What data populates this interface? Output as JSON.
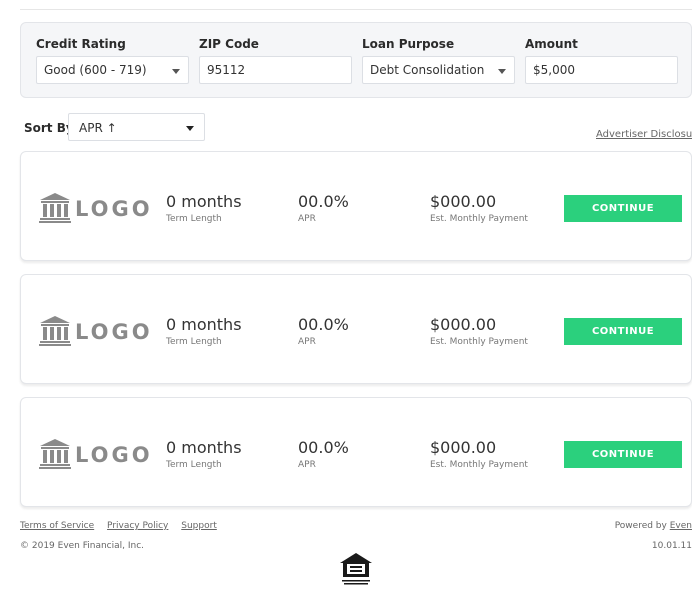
{
  "filters": {
    "credit_rating": {
      "label": "Credit Rating",
      "value": "Good (600 - 719)"
    },
    "zip_code": {
      "label": "ZIP Code",
      "value": "95112"
    },
    "loan_purpose": {
      "label": "Loan Purpose",
      "value": "Debt Consolidation"
    },
    "amount": {
      "label": "Amount",
      "value": "$5,000"
    }
  },
  "sort": {
    "label": "Sort By",
    "value": "APR ↑"
  },
  "disclosure": "Advertiser Disclosure",
  "offers": [
    {
      "logo": "LOGO",
      "term": "0 months",
      "term_label": "Term Length",
      "apr": "00.0%",
      "apr_label": "APR",
      "payment": "$000.00",
      "payment_label": "Est. Monthly Payment",
      "button": "CONTINUE"
    },
    {
      "logo": "LOGO",
      "term": "0 months",
      "term_label": "Term Length",
      "apr": "00.0%",
      "apr_label": "APR",
      "payment": "$000.00",
      "payment_label": "Est. Monthly Payment",
      "button": "CONTINUE"
    },
    {
      "logo": "LOGO",
      "term": "0 months",
      "term_label": "Term Length",
      "apr": "00.0%",
      "apr_label": "APR",
      "payment": "$000.00",
      "payment_label": "Est. Monthly Payment",
      "button": "CONTINUE"
    }
  ],
  "footer": {
    "links": [
      "Terms of Service",
      "Privacy Policy",
      "Support"
    ],
    "copyright": "© 2019 Even Financial, Inc.",
    "powered_by": "Powered by",
    "powered_link": "Even",
    "version": "10.01.11"
  },
  "colors": {
    "continue": "#2bd07d",
    "panel": "#f5f6f8",
    "logo": "#8a8a8a"
  },
  "icons": {
    "logo": "bank-icon",
    "dropdown": "chevron-down-icon",
    "footer_badge": "equal-housing-icon"
  }
}
